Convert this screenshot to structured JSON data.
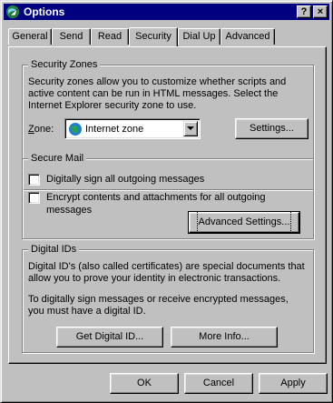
{
  "window": {
    "title": "Options",
    "help_btn": "?",
    "close_btn": "×"
  },
  "tabs": [
    {
      "label": "General",
      "active": false
    },
    {
      "label": "Send",
      "active": false
    },
    {
      "label": "Read",
      "active": false
    },
    {
      "label": "Security",
      "active": true
    },
    {
      "label": "Dial Up",
      "active": false
    },
    {
      "label": "Advanced",
      "active": false
    }
  ],
  "security_zones": {
    "label": "Security Zones",
    "desc_line1": "Security zones allow you to customize whether scripts and",
    "desc_line2": "active content can be run in HTML messages. Select the",
    "desc_line3": "Internet Explorer security zone to use.",
    "zone_label": "Zone:",
    "zone_value": "Internet zone",
    "settings_button": "Settings..."
  },
  "secure_mail": {
    "label": "Secure Mail",
    "sign_label": "Digitally sign all outgoing messages",
    "sign_checked": false,
    "encrypt_label": "Encrypt contents and attachments for all outgoing messages",
    "encrypt_checked": false,
    "advanced_button": "Advanced Settings..."
  },
  "digital_ids": {
    "label": "Digital IDs",
    "desc1_line1": "Digital ID's (also called certificates) are special documents that",
    "desc1_line2": "allow you to prove your identity in electronic transactions.",
    "desc2_line1": "To digitally sign messages or receive encrypted messages,",
    "desc2_line2": "you must have a digital ID.",
    "get_button": "Get Digital ID...",
    "more_button": "More Info..."
  },
  "footer": {
    "ok": "OK",
    "cancel": "Cancel",
    "apply": "Apply"
  }
}
